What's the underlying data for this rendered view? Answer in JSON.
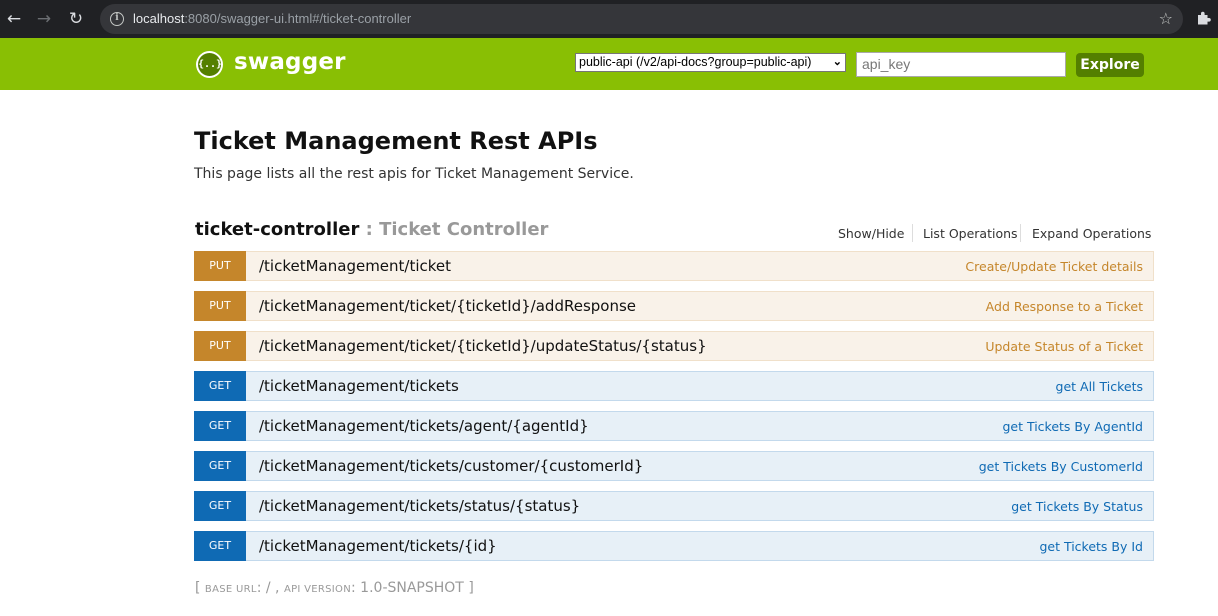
{
  "browser": {
    "url_host": "localhost",
    "url_rest": ":8080/swagger-ui.html#/ticket-controller"
  },
  "header": {
    "logo_glyph": "{..}",
    "logo_text": "swagger",
    "api_select_value": "public-api (/v2/api-docs?group=public-api)",
    "api_key_placeholder": "api_key",
    "explore_label": "Explore",
    "colors": {
      "bar": "#89bf04",
      "button": "#547f00"
    }
  },
  "main": {
    "title": "Ticket Management Rest APIs",
    "description": "This page lists all the rest apis for Ticket Management Service."
  },
  "controller": {
    "name": "ticket-controller",
    "separator": " : ",
    "description": "Ticket Controller",
    "links": [
      "Show/Hide",
      "List Operations",
      "Expand Operations"
    ]
  },
  "operations": [
    {
      "method": "PUT",
      "path": "/ticketManagement/ticket",
      "summary": "Create/Update Ticket details"
    },
    {
      "method": "PUT",
      "path": "/ticketManagement/ticket/{ticketId}/addResponse",
      "summary": "Add Response to a Ticket"
    },
    {
      "method": "PUT",
      "path": "/ticketManagement/ticket/{ticketId}/updateStatus/{status}",
      "summary": "Update Status of a Ticket"
    },
    {
      "method": "GET",
      "path": "/ticketManagement/tickets",
      "summary": "get All Tickets"
    },
    {
      "method": "GET",
      "path": "/ticketManagement/tickets/agent/{agentId}",
      "summary": "get Tickets By AgentId"
    },
    {
      "method": "GET",
      "path": "/ticketManagement/tickets/customer/{customerId}",
      "summary": "get Tickets By CustomerId"
    },
    {
      "method": "GET",
      "path": "/ticketManagement/tickets/status/{status}",
      "summary": "get Tickets By Status"
    },
    {
      "method": "GET",
      "path": "/ticketManagement/tickets/{id}",
      "summary": "get Tickets By Id"
    }
  ],
  "footer": {
    "open_bracket": "[ ",
    "base_url_label": "BASE URL",
    "base_url_value": ": / , ",
    "api_version_label": "API VERSION",
    "api_version_value": ": 1.0-SNAPSHOT ]"
  }
}
